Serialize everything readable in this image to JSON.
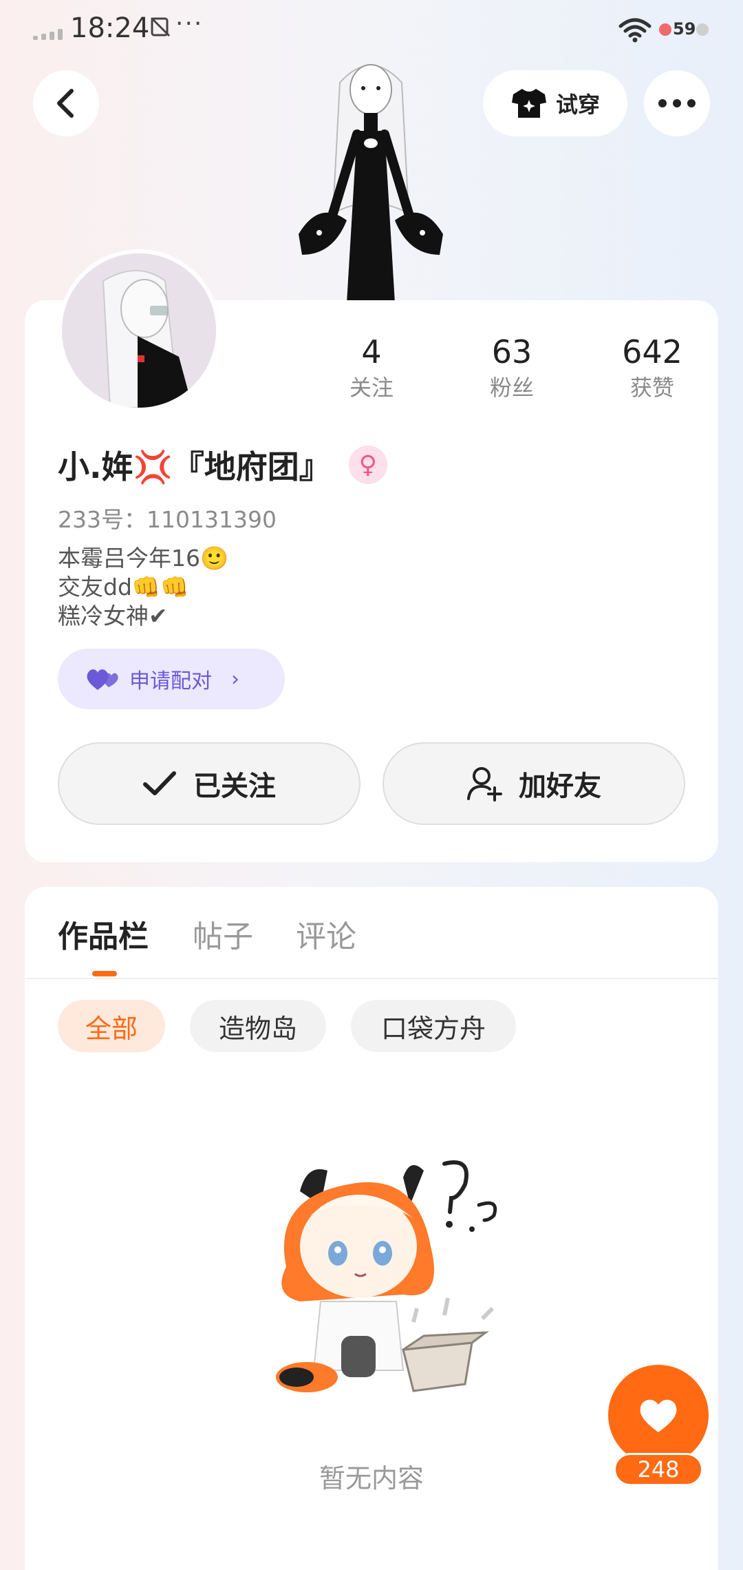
{
  "status_bar": {
    "time": "18:24",
    "notification_icon": "no-sim-icon",
    "more": "···",
    "battery": "59"
  },
  "top_bar": {
    "back_icon": "chevron-left-icon",
    "tryon_label": "试穿",
    "more_icon": "more-horizontal-icon"
  },
  "profile": {
    "stats": [
      {
        "value": "4",
        "label": "关注"
      },
      {
        "value": "63",
        "label": "粉丝"
      },
      {
        "value": "642",
        "label": "获赞"
      }
    ],
    "name": "小.姩💢『地府团』",
    "gender_symbol": "♀",
    "uid": "233号：110131390",
    "bio": [
      "本霉吕今年16🙂",
      "交友dd👊👊",
      "糕冷女神✔"
    ],
    "pair_button": "申请配对",
    "pair_chevron": "›",
    "follow_button": "已关注",
    "add_friend_button": "加好友"
  },
  "works": {
    "tabs": [
      "作品栏",
      "帖子",
      "评论"
    ],
    "active_tab": "作品栏",
    "chips": [
      "全部",
      "造物岛",
      "口袋方舟"
    ],
    "active_chip": "全部",
    "empty_text": "暂无内容"
  },
  "like_fab": {
    "count": "248"
  },
  "colors": {
    "accent": "#ff6a13",
    "pair_purple": "#6b59d9",
    "gender_pink": "#ef5a8a"
  }
}
